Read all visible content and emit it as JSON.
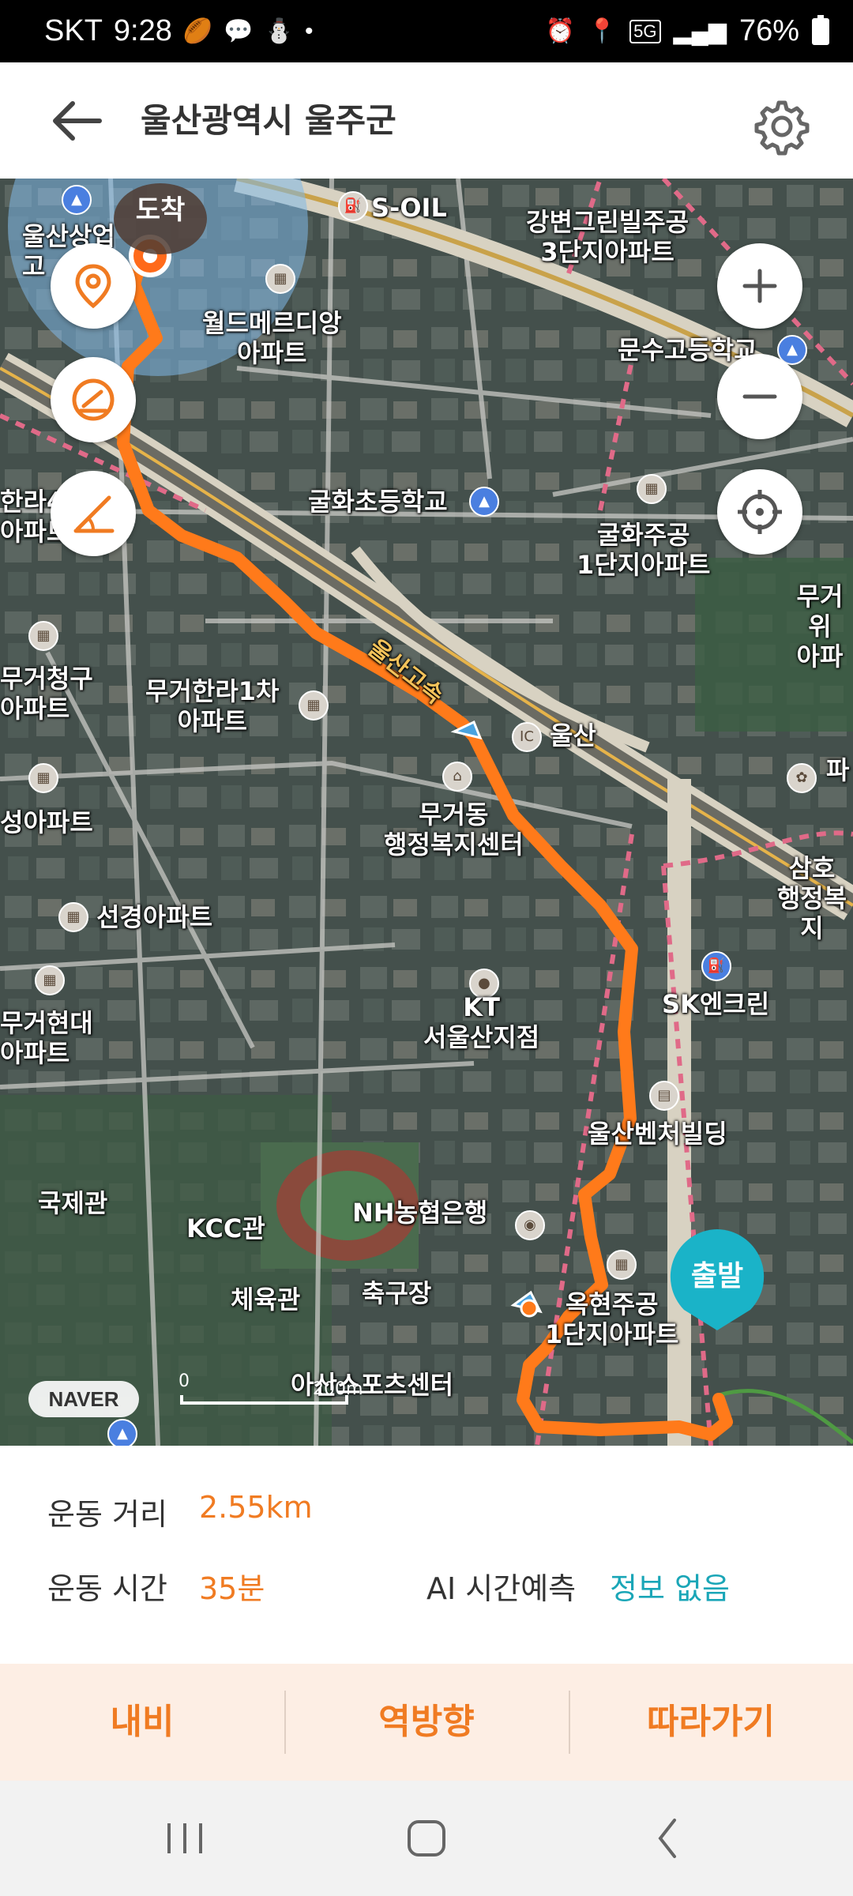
{
  "status_bar": {
    "carrier": "SKT",
    "time": "9:28",
    "network": "5G",
    "battery": "76%"
  },
  "header": {
    "title": "울산광역시 울주군"
  },
  "map": {
    "labels": {
      "arrive": "도착",
      "ulsan_hs_1": "울산상업",
      "ulsan_hs_2": "고",
      "soil": "S-OIL",
      "gangbyeon": "강변그린빌주공\n3단지아파트",
      "world": "월드메르디앙\n아파트",
      "munsu": "문수고등학교",
      "halla_left": "한라4\n아파트",
      "gulhwa_school": "굴화초등학교",
      "gulhwa_apt": "굴화주공\n1단지아파트",
      "mugeo_right": "무거위\n아파",
      "highway": "울산고속",
      "mugeo_cheonggu": "무거청구\n아파트",
      "mugeo_halla": "무거한라1차\n아파트",
      "ic": "울산",
      "mugeo_dong": "무거동\n행정복지센터",
      "park": "파",
      "seongsung": "성아파트",
      "samho": "삼호\n행정복지",
      "seongyeong": "선경아파트",
      "kt": "KT\n서울산지점",
      "sk": "SK엔크린",
      "mugeo_hyundai": "무거현대\n아파트",
      "venture": "울산벤처빌딩",
      "gukje": "국제관",
      "kcc": "KCC관",
      "nh": "NH농협은행",
      "gym": "체육관",
      "soccer": "축구장",
      "okhyeon": "옥현주공\n1단지아파트",
      "sports": "아산스포츠센터",
      "start": "출발"
    },
    "naver_logo": "NAVER",
    "scale_zero": "0",
    "scale_label": "200m",
    "route_color": "#ff7a1a",
    "start_color": "#1ab3c8"
  },
  "stats": {
    "distance_label": "운동 거리",
    "distance_value": "2.55km",
    "time_label": "운동 시간",
    "time_value": "35분",
    "ai_label": "AI 시간예측",
    "ai_value": "정보 없음",
    "accent_orange": "#f07b22",
    "accent_teal": "#1aa6b7"
  },
  "actions": {
    "navi": "내비",
    "reverse": "역방향",
    "follow": "따라가기"
  }
}
